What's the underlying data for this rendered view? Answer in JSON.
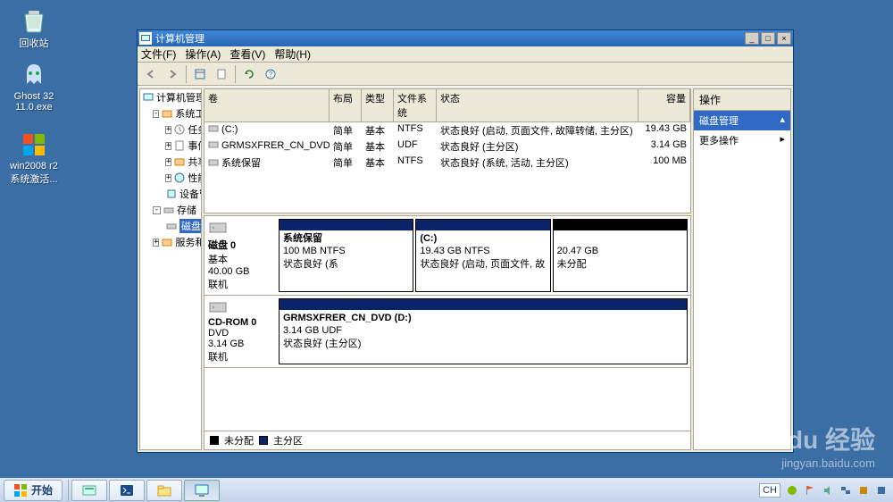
{
  "desktop": {
    "icons": [
      {
        "label": "回收站",
        "name": "recycle-bin"
      },
      {
        "label": "Ghost 32\n11.0.exe",
        "name": "ghost-exe"
      },
      {
        "label": "win2008 r2\n系统激活...",
        "name": "win2008-activator"
      }
    ]
  },
  "window": {
    "title": "计算机管理",
    "menu": {
      "file": "文件(F)",
      "action": "操作(A)",
      "view": "查看(V)",
      "help": "帮助(H)"
    }
  },
  "tree": {
    "root": "计算机管理(本地)",
    "system_tools": "系统工具",
    "task_scheduler": "任务计划程序",
    "event_viewer": "事件查看器",
    "shared_folders": "共享文件夹",
    "performance": "性能",
    "device_manager": "设备管理器",
    "storage": "存储",
    "disk_mgmt": "磁盘管理",
    "services_apps": "服务和应用程序"
  },
  "volume_list": {
    "headers": {
      "name": "卷",
      "layout": "布局",
      "type": "类型",
      "fs": "文件系统",
      "status": "状态",
      "capacity": "容量"
    },
    "rows": [
      {
        "name": "(C:)",
        "layout": "简单",
        "type": "基本",
        "fs": "NTFS",
        "status": "状态良好 (启动, 页面文件, 故障转储, 主分区)",
        "capacity": "19.43 GB"
      },
      {
        "name": "GRMSXFRER_CN_DVD (D:)",
        "layout": "简单",
        "type": "基本",
        "fs": "UDF",
        "status": "状态良好 (主分区)",
        "capacity": "3.14 GB"
      },
      {
        "name": "系统保留",
        "layout": "简单",
        "type": "基本",
        "fs": "NTFS",
        "status": "状态良好 (系统, 活动, 主分区)",
        "capacity": "100 MB"
      }
    ]
  },
  "disks": [
    {
      "label": "磁盘 0",
      "type": "基本",
      "size": "40.00 GB",
      "state": "联机",
      "vols": [
        {
          "name": "系统保留",
          "line2": "100 MB NTFS",
          "line3": "状态良好 (系"
        },
        {
          "name": "(C:)",
          "line2": "19.43 GB NTFS",
          "line3": "状态良好 (启动, 页面文件, 故"
        },
        {
          "name": "",
          "line2": "20.47 GB",
          "line3": "未分配",
          "unalloc": true
        }
      ]
    },
    {
      "label": "CD-ROM 0",
      "type": "DVD",
      "size": "3.14 GB",
      "state": "联机",
      "vols": [
        {
          "name": "GRMSXFRER_CN_DVD  (D:)",
          "line2": "3.14 GB UDF",
          "line3": "状态良好 (主分区)"
        }
      ]
    }
  ],
  "legend": {
    "unalloc": "未分配",
    "primary": "主分区"
  },
  "actions": {
    "header": "操作",
    "category": "磁盘管理",
    "more": "更多操作"
  },
  "taskbar": {
    "start": "开始",
    "lang": "CH"
  },
  "watermark": {
    "brand": "Baidu 经验",
    "url": "jingyan.baidu.com"
  }
}
